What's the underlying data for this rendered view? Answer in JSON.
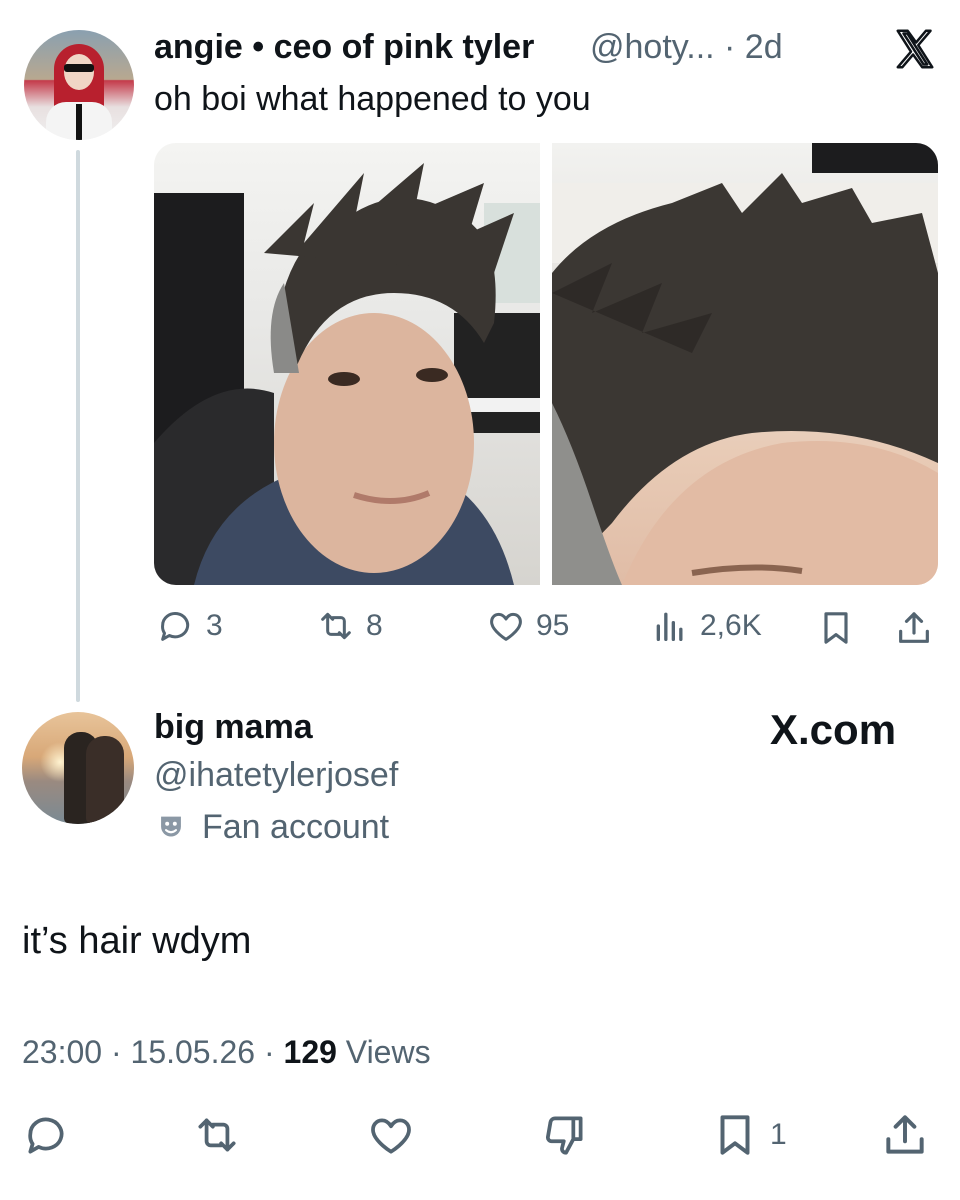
{
  "tweet": {
    "author_name": "angie • ceo of pink tyler",
    "author_meta": "@hoty... · 2d",
    "text": "oh boi what happened to you",
    "stats": {
      "replies": "3",
      "reposts": "8",
      "likes": "95",
      "views": "2,6K"
    }
  },
  "reply": {
    "author_name": "big mama",
    "author_handle": "@ihatetylerjosef",
    "badge": "Fan account",
    "site_label": "X.com",
    "text": "it’s hair wdym",
    "time": "23:00",
    "date": "15.05.26",
    "views_count": "129",
    "views_label": "Views",
    "actions": {
      "bookmarks": "1"
    }
  },
  "icons": {
    "logo": "x-logo-icon",
    "reply": "speech-bubble-icon",
    "repost": "repost-arrows-icon",
    "like": "heart-icon",
    "views": "bar-chart-icon",
    "bookmark": "bookmark-icon",
    "share": "share-upload-icon",
    "dislike": "thumbs-down-icon",
    "badge": "theater-mask-icon"
  },
  "colors": {
    "text": "#0f1419",
    "muted": "#536471",
    "thread_line": "#cfd9de"
  }
}
